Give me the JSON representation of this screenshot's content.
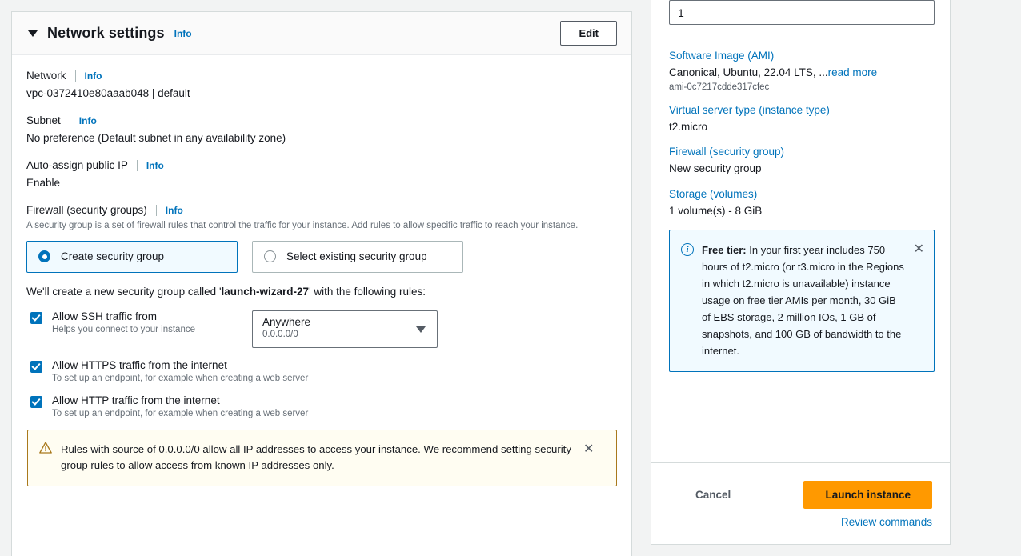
{
  "network_settings": {
    "title": "Network settings",
    "info_label": "Info",
    "edit_label": "Edit",
    "caret_icon": "caret-down-icon",
    "fields": [
      {
        "label": "Network",
        "info": "Info",
        "value": "vpc-0372410e80aaab048 | default"
      },
      {
        "label": "Subnet",
        "info": "Info",
        "value": "No preference (Default subnet in any availability zone)"
      },
      {
        "label": "Auto-assign public IP",
        "info": "Info",
        "value": "Enable"
      }
    ],
    "firewall": {
      "label": "Firewall (security groups)",
      "info": "Info",
      "description": "A security group is a set of firewall rules that control the traffic for your instance. Add rules to allow specific traffic to reach your instance.",
      "options": [
        {
          "label": "Create security group",
          "selected": true
        },
        {
          "label": "Select existing security group",
          "selected": false
        }
      ],
      "note_prefix": "We'll create a new security group called '",
      "note_name": "launch-wizard-27",
      "note_suffix": "' with the following rules:",
      "rules": [
        {
          "title": "Allow SSH traffic from",
          "subtitle": "Helps you connect to your instance",
          "checked": true,
          "has_select": true,
          "select_value": "Anywhere",
          "select_sub": "0.0.0.0/0"
        },
        {
          "title": "Allow HTTPS traffic from the internet",
          "subtitle": "To set up an endpoint, for example when creating a web server",
          "checked": true,
          "has_select": false
        },
        {
          "title": "Allow HTTP traffic from the internet",
          "subtitle": "To set up an endpoint, for example when creating a web server",
          "checked": true,
          "has_select": false
        }
      ]
    },
    "warning": {
      "icon": "warning-triangle-icon",
      "text": "Rules with source of 0.0.0.0/0 allow all IP addresses to access your instance. We recommend setting security group rules to allow access from known IP addresses only.",
      "close_icon": "close-icon",
      "close_label": "✕"
    }
  },
  "summary": {
    "quantity_value": "1",
    "items": [
      {
        "link": "Software Image (AMI)",
        "value": "Canonical, Ubuntu, 22.04 LTS, ...",
        "value_link": "read more",
        "sub": "ami-0c7217cdde317cfec"
      },
      {
        "link": "Virtual server type (instance type)",
        "value": "t2.micro",
        "value_link": "",
        "sub": ""
      },
      {
        "link": "Firewall (security group)",
        "value": "New security group",
        "value_link": "",
        "sub": ""
      },
      {
        "link": "Storage (volumes)",
        "value": "1 volume(s) - 8 GiB",
        "value_link": "",
        "sub": ""
      }
    ],
    "free_tier": {
      "icon": "info-circle-icon",
      "icon_glyph": "i",
      "title": "Free tier:",
      "body": " In your first year includes 750 hours of t2.micro (or t3.micro in the Regions in which t2.micro is unavailable) instance usage on free tier AMIs per month, 30 GiB of EBS storage, 2 million IOs, 1 GB of snapshots, and 100 GB of bandwidth to the internet.",
      "close_icon": "close-icon",
      "close_label": "✕"
    },
    "actions": {
      "cancel_label": "Cancel",
      "launch_label": "Launch instance",
      "review_label": "Review commands"
    }
  },
  "colors": {
    "accent_blue": "#0073bb",
    "launch_orange": "#ff9900",
    "warning_border": "#a9791c",
    "warning_bg": "#fffdf2",
    "info_bg": "#f1faff",
    "page_bg": "#f2f3f3"
  }
}
